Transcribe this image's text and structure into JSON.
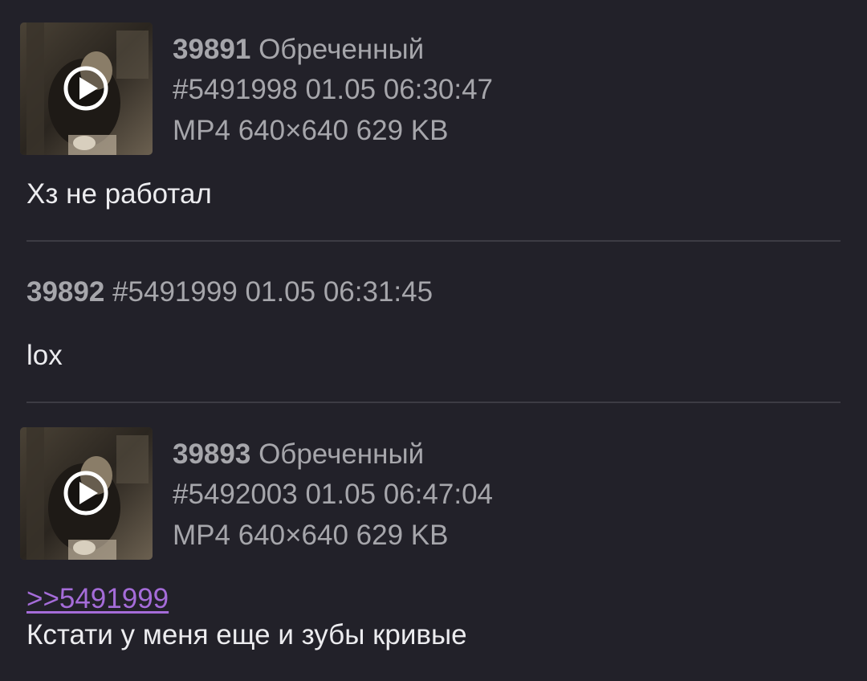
{
  "posts": [
    {
      "number": "39891",
      "name": "Обреченный",
      "id_time": "#5491998 01.05 06:30:47",
      "file_info": "MP4 640×640 629 KB",
      "comment": "Хз не работал"
    },
    {
      "number": "39892",
      "id_time": "#5491999 01.05 06:31:45",
      "comment": "lox"
    },
    {
      "number": "39893",
      "name": "Обреченный",
      "id_time": "#5492003 01.05 06:47:04",
      "file_info": "MP4 640×640 629 KB",
      "reply_link": ">>5491999",
      "comment": "Кстати у меня еще и зубы кривые"
    }
  ],
  "colors": {
    "background": "#222129",
    "meta_text": "#a6a6ab",
    "comment_text": "#ececef",
    "link": "#a56cd9",
    "divider": "#3d3c44"
  },
  "icons": {
    "video_overlay": "play-icon"
  }
}
